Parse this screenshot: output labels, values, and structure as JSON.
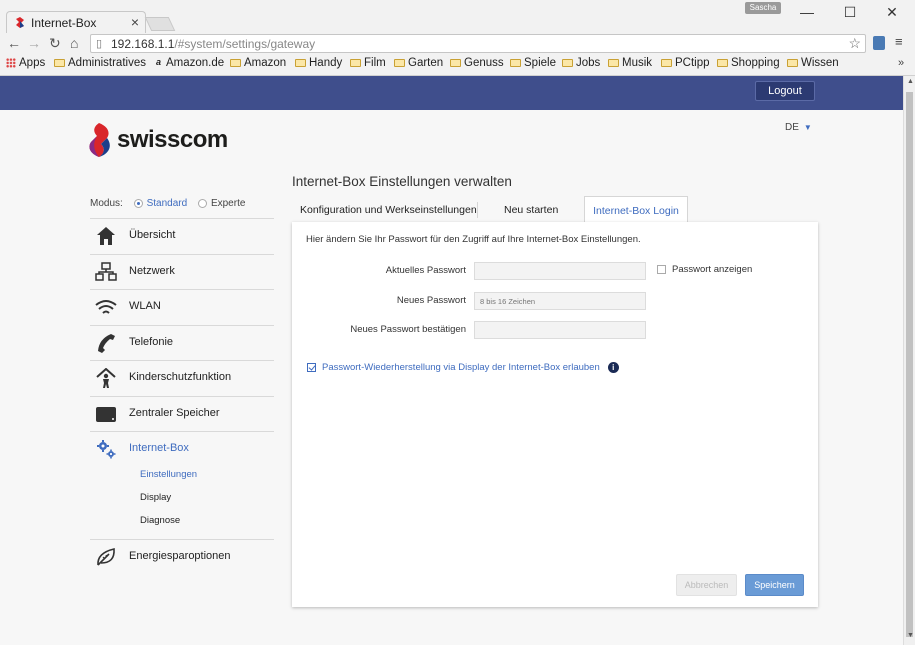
{
  "browser": {
    "tab_title": "Internet-Box",
    "tab_close": "×",
    "user_label": "Sascha",
    "url_host": "192.168.1.1",
    "url_path": "/#system/settings/gateway",
    "bookmarks": [
      "Apps",
      "Administratives",
      "Amazon.de",
      "Amazon",
      "Handy",
      "Film",
      "Garten",
      "Genuss",
      "Spiele",
      "Jobs",
      "Musik",
      "PCtipp",
      "Shopping",
      "Wissen"
    ],
    "more": "»"
  },
  "header": {
    "logout": "Logout",
    "brand": "swisscom",
    "language": "DE"
  },
  "sidebar": {
    "mode_label": "Modus:",
    "mode_standard": "Standard",
    "mode_expert": "Experte",
    "items": [
      {
        "label": "Übersicht",
        "icon": "house-icon"
      },
      {
        "label": "Netzwerk",
        "icon": "network-icon"
      },
      {
        "label": "WLAN",
        "icon": "wifi-icon"
      },
      {
        "label": "Telefonie",
        "icon": "phone-icon"
      },
      {
        "label": "Kinderschutzfunktion",
        "icon": "child-protection-icon"
      },
      {
        "label": "Zentraler Speicher",
        "icon": "storage-icon"
      },
      {
        "label": "Internet-Box",
        "icon": "gears-icon"
      },
      {
        "label": "Energiesparoptionen",
        "icon": "leaf-icon"
      }
    ],
    "subitems": [
      "Einstellungen",
      "Display",
      "Diagnose"
    ]
  },
  "main": {
    "heading": "Internet-Box Einstellungen verwalten",
    "tabs": [
      "Konfiguration und Werkseinstellungen",
      "Neu starten",
      "Internet-Box Login"
    ],
    "intro": "Hier ändern Sie Ihr Passwort für den Zugriff auf Ihre Internet-Box Einstellungen.",
    "fields": [
      {
        "label": "Aktuelles Passwort",
        "placeholder": ""
      },
      {
        "label": "Neues Passwort",
        "placeholder": "8 bis 16 Zeichen"
      },
      {
        "label": "Neues Passwort bestätigen",
        "placeholder": ""
      }
    ],
    "show_password": "Passwort anzeigen",
    "recovery": "Passwort-Wiederherstellung via Display der Internet-Box erlauben",
    "info": "i",
    "cancel": "Abbrechen",
    "save": "Speichern"
  },
  "colors": {
    "header_band": "#3f4e8c",
    "accent": "#3f6cbf",
    "save_button": "#6a9bd6"
  }
}
